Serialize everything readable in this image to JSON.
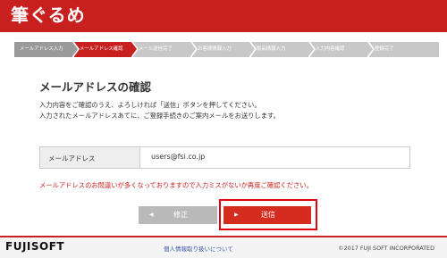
{
  "header": {
    "logo": "筆ぐるめ",
    "brand_color": "#c8201e"
  },
  "steps": {
    "items": [
      {
        "label": "メールアドレス入力",
        "state": "done"
      },
      {
        "label": "メールアドレス確認",
        "state": "active"
      },
      {
        "label": "メール送信完了",
        "state": "pending"
      },
      {
        "label": "お客様情報入力",
        "state": "pending"
      },
      {
        "label": "製品情報入力",
        "state": "pending"
      },
      {
        "label": "入力内容確認",
        "state": "pending"
      },
      {
        "label": "登録完了",
        "state": "pending"
      }
    ]
  },
  "main": {
    "title": "メールアドレスの確認",
    "instruction_line1": "入力内容をご確認のうえ、よろしければ「送信」ボタンを押してください。",
    "instruction_line2": "入力されたメールアドレスあてに、ご登録手続きのご案内メールをお送りします。",
    "email_label": "メールアドレス",
    "email_value": "users@fsi.co.jp",
    "warning": "メールアドレスのお問違いが多くなっておりますので入力ミスがないか再度ご確認ください。"
  },
  "buttons": {
    "back_label": "修正",
    "back_icon": "arrow-left-icon",
    "send_label": "送信",
    "send_icon": "arrow-right-icon",
    "send_color": "#d42d1f",
    "highlight_color": "#e3000f"
  },
  "footer": {
    "logo": "FUJISOFT",
    "privacy_link": "個人情報取り扱いについて",
    "copyright": "©2017 FUJI SOFT INCORPORATED"
  }
}
